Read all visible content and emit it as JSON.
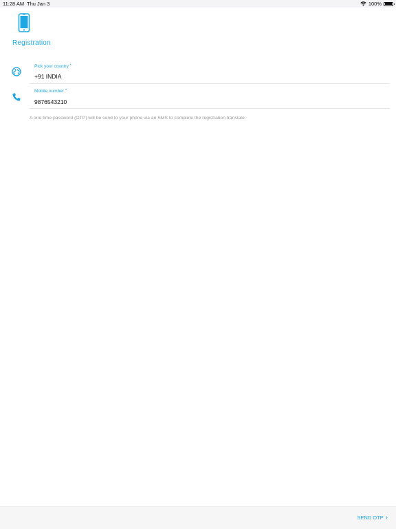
{
  "status_bar": {
    "time": "11:28 AM",
    "date": "Thu Jan 3",
    "battery_percent": "100%",
    "wifi_icon": "wifi-icon",
    "battery_icon": "battery-icon"
  },
  "header": {
    "icon": "phone-icon",
    "title": "Registration"
  },
  "fields": [
    {
      "icon": "globe-icon",
      "label": "Pick your country",
      "required_mark": "*",
      "value": "+91 INDIA"
    },
    {
      "icon": "phone-call-icon",
      "label": "Mobile number",
      "required_mark": "*",
      "value": "9876543210"
    }
  ],
  "note": "A one time password (OTP) will be send to your phone via an SMS to complete the registration translate.",
  "footer": {
    "send_label": "SEND OTP",
    "chevron": "›"
  },
  "colors": {
    "accent": "#1ea7e1",
    "muted_text": "#9a9a9a",
    "divider": "#e3e3e3",
    "footer_bg": "#f6f6f7"
  }
}
